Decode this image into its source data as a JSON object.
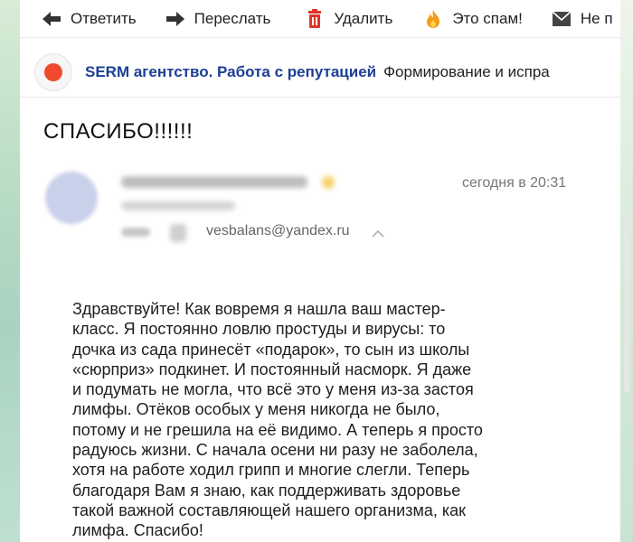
{
  "toolbar": {
    "reply": {
      "label": "Ответить",
      "icon": "reply-arrow-icon"
    },
    "forward": {
      "label": "Переслать",
      "icon": "forward-arrow-icon"
    },
    "delete": {
      "label": "Удалить",
      "icon": "trash-icon",
      "color": "#e0342b"
    },
    "spam": {
      "label": "Это спам!",
      "icon": "flame-icon",
      "color": "#f59b1a"
    },
    "unread": {
      "label": "Не п",
      "icon": "envelope-icon"
    }
  },
  "thread": {
    "sender": "SERM агентство. Работа с репутацией",
    "snippet": "Формирование и испра",
    "indicator_color": "#f04a2e"
  },
  "message": {
    "subject": "СПАСИБО!!!!!!",
    "date": "сегодня в 20:31",
    "recipient": "vesbalans@yandex.ru",
    "body_lines": [
      "Здравствуйте! Как вовремя я нашла ваш мастер-",
      "класс. Я постоянно ловлю простуды и вирусы: то",
      "дочка из сада принесёт «подарок», то сын из школы",
      "«сюрприз» подкинет. И постоянный насморк. Я даже",
      "и подумать не могла, что всё это у меня из-за застоя",
      "лимфы. Отёков особых у меня никогда не было,",
      "потому и не грешила на её видимо. А теперь я просто",
      "радуюсь жизни. С начала осени ни разу не заболела,",
      "хотя на работе ходил грипп и многие слегли. Теперь",
      "благодаря Вам я знаю, как поддерживать здоровье",
      "такой важной составляющей нашего организма, как",
      "лимфа. Спасибо!"
    ]
  }
}
